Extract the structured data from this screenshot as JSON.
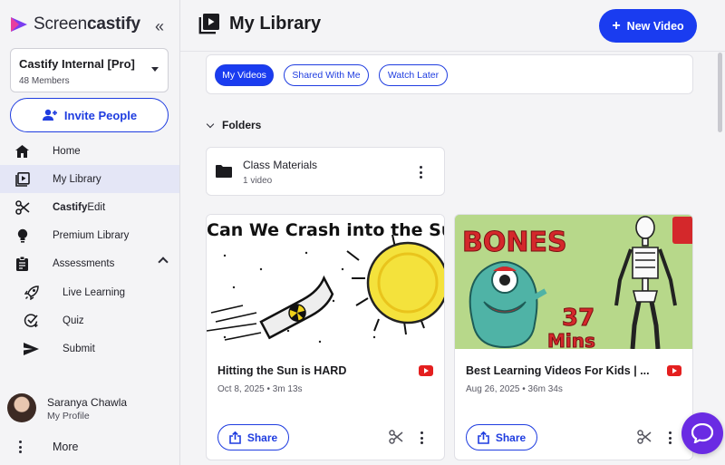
{
  "brand": {
    "name_light": "Screen",
    "name_bold": "castify"
  },
  "sidebar": {
    "team": {
      "name": "Castify Internal [Pro]",
      "members": "48 Members"
    },
    "invite_label": "Invite People",
    "items": [
      {
        "label": "Home",
        "icon": "home-icon"
      },
      {
        "label": "My Library",
        "icon": "library-icon",
        "active": true
      },
      {
        "label_bold": "Castify",
        "label_rest": "Edit",
        "icon": "scissors-icon"
      },
      {
        "label": "Premium Library",
        "icon": "lightbulb-icon"
      },
      {
        "label": "Assessments",
        "icon": "clipboard-icon"
      },
      {
        "label": "Live Learning",
        "icon": "rocket-icon"
      },
      {
        "label": "Quiz",
        "icon": "quiz-check-icon"
      },
      {
        "label": "Submit",
        "icon": "send-icon"
      }
    ],
    "profile": {
      "name": "Saranya Chawla",
      "sub": "My Profile"
    },
    "more_label": "More"
  },
  "main": {
    "title": "My Library",
    "new_video_label": "New Video",
    "filters": [
      "My Videos",
      "Shared With Me",
      "Watch Later"
    ],
    "selected_filter": "My Videos",
    "folders_label": "Folders",
    "folders": [
      {
        "name": "Class Materials",
        "count": "1 video"
      }
    ],
    "videos": [
      {
        "title": "Hitting the Sun is HARD",
        "meta": "Oct 8, 2025 • 3m 13s",
        "thumb_text": "Can We Crash into the Sun?"
      },
      {
        "title": "Best Learning Videos For Kids | ...",
        "meta": "Aug 26, 2025 • 36m 34s",
        "thumb_text": "BONES",
        "thumb_text_2": "37",
        "thumb_text_3": "Mins"
      }
    ],
    "share_label": "Share"
  },
  "colors": {
    "accent": "#1a3cf0",
    "chat": "#6a2be3",
    "youtube": "#e41f1f"
  }
}
